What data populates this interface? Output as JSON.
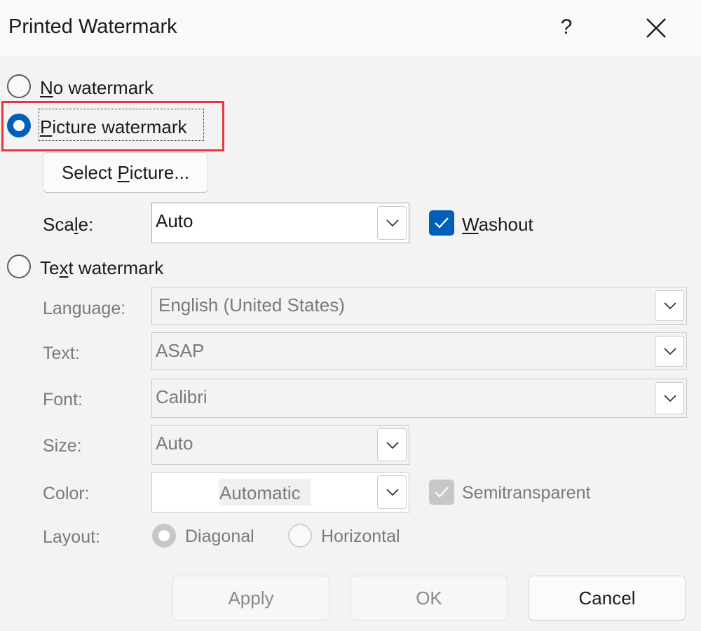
{
  "dialog": {
    "title": "Printed Watermark",
    "help_label": "?",
    "close_icon": "close-icon"
  },
  "options": {
    "no_watermark": {
      "pre": "",
      "key": "N",
      "post": "o watermark",
      "selected": false
    },
    "picture_watermark": {
      "pre": "",
      "key": "P",
      "post": "icture watermark",
      "selected": true
    },
    "text_watermark": {
      "pre": "Te",
      "key": "x",
      "post": "t watermark",
      "selected": false
    }
  },
  "picture": {
    "select_button": {
      "pre": "Select ",
      "key": "P",
      "post": "icture..."
    },
    "scale_label": {
      "pre": "Sca",
      "key": "l",
      "post": "e:"
    },
    "scale_value": "Auto",
    "washout": {
      "pre": "",
      "key": "W",
      "post": "ashout",
      "checked": true
    }
  },
  "text": {
    "language_label": "Language:",
    "language_value": "English (United States)",
    "text_label": "Text:",
    "text_value": "ASAP",
    "font_label": "Font:",
    "font_value": "Calibri",
    "size_label": "Size:",
    "size_value": "Auto",
    "color_label": "Color:",
    "color_value": "Automatic",
    "semitransparent_label": "Semitransparent",
    "semitransparent_checked": true,
    "layout_label": "Layout:",
    "layout_options": [
      {
        "label": "Diagonal",
        "selected": true
      },
      {
        "label": "Horizontal",
        "selected": false
      }
    ]
  },
  "buttons": {
    "apply": "Apply",
    "ok": "OK",
    "cancel": "Cancel"
  },
  "colors": {
    "accent": "#005fb8",
    "highlight": "#e8383d",
    "disabled_text": "#7a7a7a"
  }
}
